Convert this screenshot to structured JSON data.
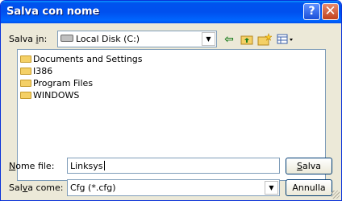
{
  "title": "Salva con nome",
  "titlebar_buttons": {
    "help": "?",
    "close": "✕"
  },
  "location": {
    "label_pre": "Salva ",
    "label_key": "i",
    "label_post": "n:",
    "value": "Local Disk (C:)",
    "icon": "drive-icon"
  },
  "toolbar": [
    {
      "name": "back-button",
      "icon": "back-arrow-icon"
    },
    {
      "name": "up-folder-button",
      "icon": "up-folder-icon"
    },
    {
      "name": "new-folder-button",
      "icon": "new-folder-icon"
    },
    {
      "name": "view-menu-button",
      "icon": "view-menu-icon"
    }
  ],
  "files": [
    {
      "label": "Documents and Settings",
      "icon": "folder-icon"
    },
    {
      "label": "I386",
      "icon": "folder-icon"
    },
    {
      "label": "Program Files",
      "icon": "folder-icon"
    },
    {
      "label": "WINDOWS",
      "icon": "folder-icon"
    }
  ],
  "filename": {
    "label_key": "N",
    "label_rest": "ome file:",
    "value": "Linksys"
  },
  "filetype": {
    "label_pre": "Sal",
    "label_key": "v",
    "label_post": "a come:",
    "value": "Cfg (*.cfg)"
  },
  "buttons": {
    "save_key": "S",
    "save_rest": "alva",
    "cancel": "Annulla"
  },
  "colors": {
    "titlebar": "#0054e3",
    "face": "#ece9d8",
    "border": "#7f9db9",
    "folder": "#f4d066"
  }
}
